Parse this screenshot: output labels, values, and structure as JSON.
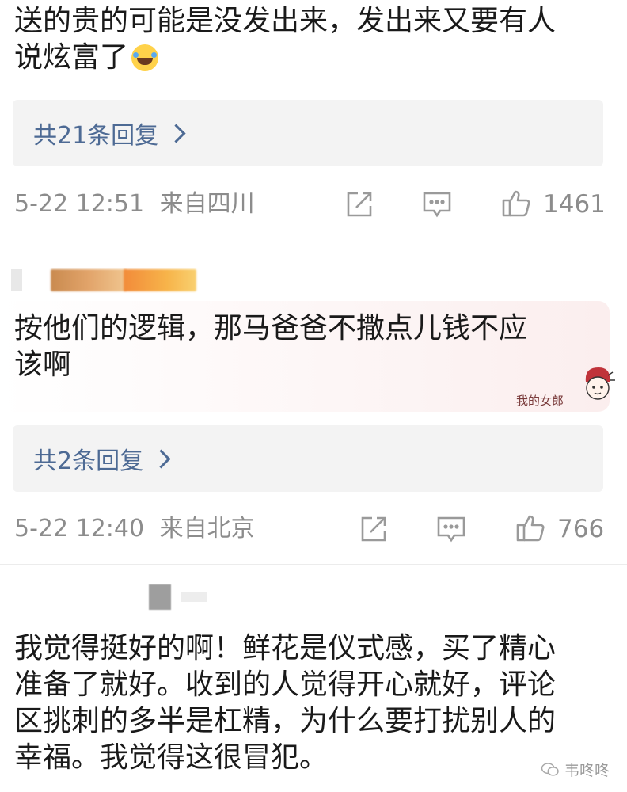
{
  "comments": [
    {
      "text": "送的贵的可能是没发出来，发出来又要有人\n说炫富了",
      "emoji": "laughing-crying-emoji",
      "replies_label": "共21条回复",
      "timestamp": "5-22 12:51",
      "location": "来自四川",
      "likes": "1461"
    },
    {
      "text": "按他们的逻辑，那马爸爸不撒点儿钱不应\n该啊",
      "sticker_text": "我的女郎",
      "replies_label": "共2条回复",
      "timestamp": "5-22 12:40",
      "location": "来自北京",
      "likes": "766"
    },
    {
      "text": "我觉得挺好的啊！鲜花是仪式感，买了精心\n准备了就好。收到的人觉得开心就好，评论\n区挑刺的多半是杠精，为什么要打扰别人的\n幸福。我觉得这很冒犯。"
    }
  ],
  "watermark": "韦咚咚",
  "icons": [
    "share-icon",
    "comment-icon",
    "like-icon",
    "chevron-right-icon",
    "wechat-icon"
  ],
  "colors": {
    "link": "#4d6a94",
    "meta": "#8c8c8c",
    "reply_bg": "#f3f3f3"
  }
}
